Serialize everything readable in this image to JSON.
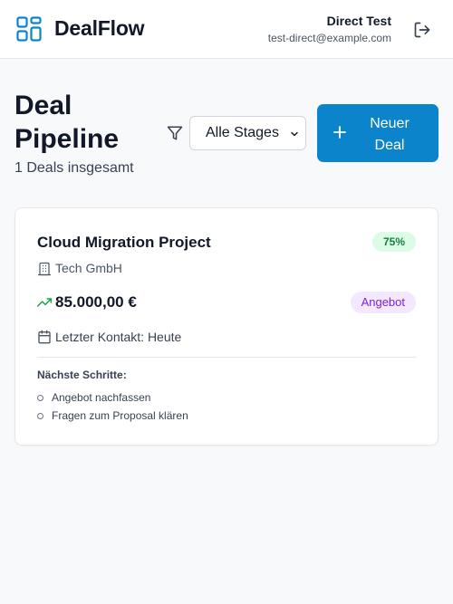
{
  "header": {
    "brand": "DealFlow",
    "user_name": "Direct Test",
    "user_email": "test-direct@example.com"
  },
  "page": {
    "title": "Deal Pipeline",
    "deal_count": "1 Deals insgesamt",
    "stage_filter": {
      "selected": "Alle Stages"
    },
    "new_deal_label": "Neuer Deal"
  },
  "deals": [
    {
      "title": "Cloud Migration Project",
      "probability": "75%",
      "company": "Tech GmbH",
      "amount": "85.000,00 €",
      "stage": "Angebot",
      "last_contact": "Letzter Kontakt: Heute",
      "next_steps_label": "Nächste Schritte:",
      "next_steps": [
        "Angebot nachfassen",
        "Fragen zum Proposal klären"
      ]
    }
  ],
  "colors": {
    "primary": "#0b84cc",
    "probability_bg": "#dcfce7",
    "probability_text": "#15803d",
    "stage_bg": "#f3e8ff",
    "stage_text": "#7e22ce",
    "trend_icon": "#16a34a"
  },
  "icons": {
    "logo": "dashboard-grid-icon",
    "logout": "logout-icon",
    "filter": "filter-icon",
    "plus": "plus-icon",
    "company": "building-icon",
    "amount": "trending-up-icon",
    "last_contact": "calendar-icon"
  }
}
